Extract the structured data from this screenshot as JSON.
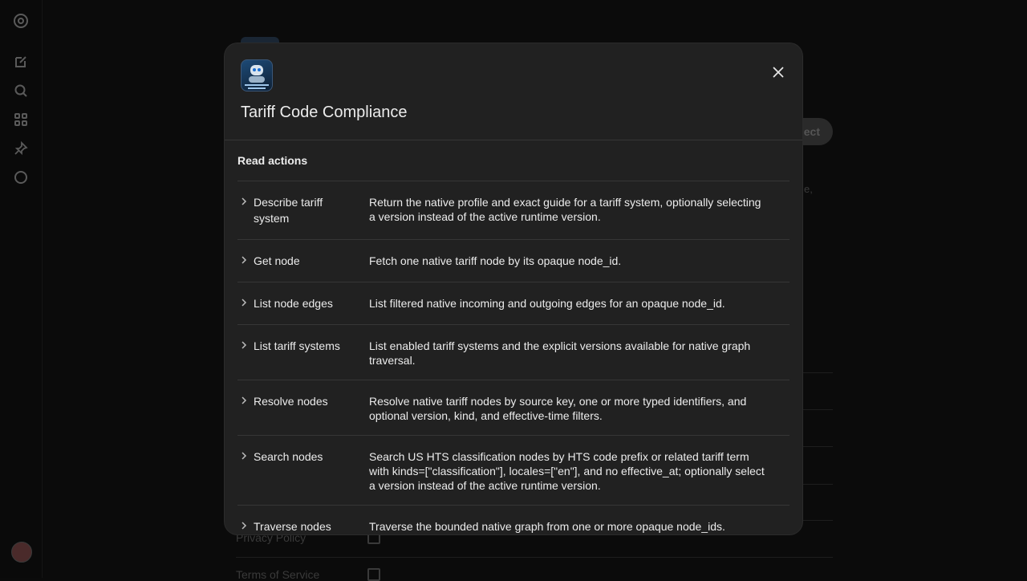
{
  "rail": {
    "icons": [
      "logo-icon",
      "compose-icon",
      "search-icon",
      "apps-icon",
      "pin-icon",
      "chat-icon"
    ]
  },
  "background": {
    "connect_label": "ect",
    "trail_text": "e,",
    "links": [
      {
        "label": "Privacy Policy"
      },
      {
        "label": "Terms of Service"
      }
    ]
  },
  "modal": {
    "title": "Tariff Code Compliance",
    "app_icon": "robot-app-icon",
    "section_label": "Read actions",
    "actions": [
      {
        "name": "Describe tariff system",
        "description": "Return the native profile and exact guide for a tariff system, optionally selecting a version instead of the active runtime version."
      },
      {
        "name": "Get node",
        "description": "Fetch one native tariff node by its opaque node_id."
      },
      {
        "name": "List node edges",
        "description": "List filtered native incoming and outgoing edges for an opaque node_id."
      },
      {
        "name": "List tariff systems",
        "description": "List enabled tariff systems and the explicit versions available for native graph traversal."
      },
      {
        "name": "Resolve nodes",
        "description": "Resolve native tariff nodes by source key, one or more typed identifiers, and optional version, kind, and effective-time filters."
      },
      {
        "name": "Search nodes",
        "description": "Search US HTS classification nodes by HTS code prefix or related tariff term with kinds=[\"classification\"], locales=[\"en\"], and no effective_at; optionally select a version instead of the active runtime version."
      },
      {
        "name": "Traverse nodes",
        "description": "Traverse the bounded native graph from one or more opaque node_ids."
      }
    ]
  }
}
